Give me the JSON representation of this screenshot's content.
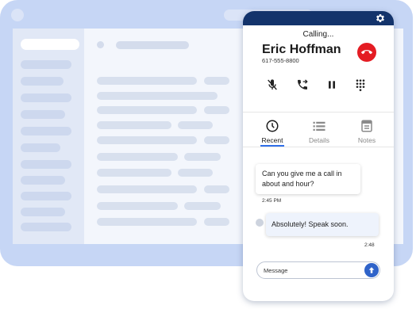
{
  "call": {
    "status": "Calling...",
    "name": "Eric Hoffman",
    "number": "617-555-8800"
  },
  "controls": {
    "icons": [
      "mute-icon",
      "transfer-icon",
      "pause-icon",
      "dialpad-icon"
    ]
  },
  "tabs": [
    {
      "label": "Recent",
      "icon": "clock-icon",
      "active": true
    },
    {
      "label": "Details",
      "icon": "list-icon",
      "active": false
    },
    {
      "label": "Notes",
      "icon": "notes-icon",
      "active": false
    }
  ],
  "messages": [
    {
      "text": "Can you give me a call in about and hour?",
      "time": "2:45 PM"
    },
    {
      "text": "Absolutely! Speak soon.",
      "time": "2:48"
    }
  ],
  "input": {
    "placeholder": "Message"
  },
  "colors": {
    "header": "#13336b",
    "hangup": "#e41c23",
    "accent": "#2f6ee8",
    "send": "#2f63c9"
  }
}
